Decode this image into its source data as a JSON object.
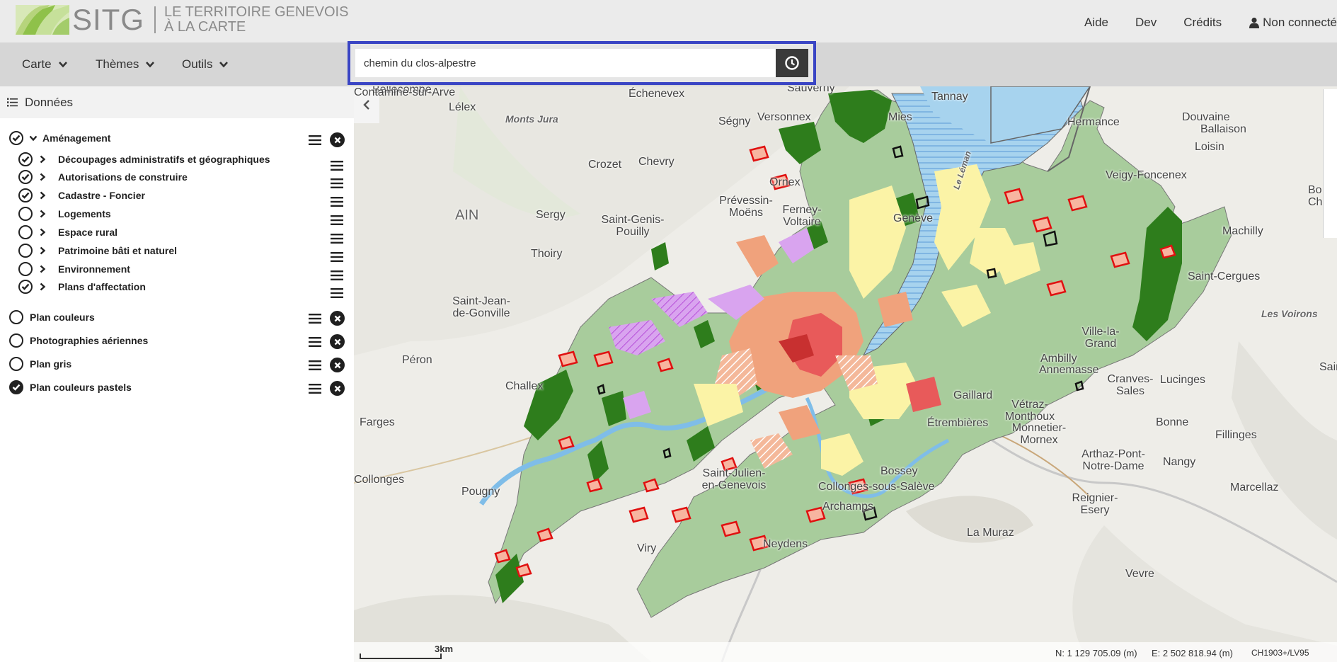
{
  "header": {
    "logo_main": "SITG",
    "logo_sub_1": "LE TERRITOIRE GENEVOIS",
    "logo_sub_2": "À LA CARTE",
    "nav": [
      "Aide",
      "Dev",
      "Crédits"
    ],
    "user": "Non connecté"
  },
  "toolbar": {
    "menus": [
      "Carte",
      "Thèmes",
      "Outils"
    ],
    "search_value": "chemin du clos-alpestre"
  },
  "sidebar": {
    "title": "Données",
    "groups": [
      {
        "label": "Aménagement",
        "checked": true,
        "expanded": true
      },
      {
        "label": "Plan couleurs",
        "checked": false
      },
      {
        "label": "Photographies aériennes",
        "checked": false
      },
      {
        "label": "Plan gris",
        "checked": false
      },
      {
        "label": "Plan couleurs pastels",
        "checked": true
      }
    ],
    "sublayers": [
      {
        "label": "Découpages administratifs et géographiques",
        "checked": true
      },
      {
        "label": "Autorisations de construire",
        "checked": true
      },
      {
        "label": "Cadastre - Foncier",
        "checked": true
      },
      {
        "label": "Logements",
        "checked": false
      },
      {
        "label": "Espace rural",
        "checked": false
      },
      {
        "label": "Patrimoine bâti et naturel",
        "checked": false
      },
      {
        "label": "Environnement",
        "checked": false
      },
      {
        "label": "Plans d'affectation",
        "checked": true
      }
    ]
  },
  "map": {
    "places": [
      "Bellecombe",
      "Lélex",
      "Échenevex",
      "Sauverny",
      "Tannay",
      "Monts Jura",
      "Ségny",
      "Versonnex",
      "Mies",
      "Hermance",
      "Douvaine",
      "Ballaison",
      "Loisin",
      "Crozet",
      "Chevry",
      "Ornex",
      "Veigy-Foncenex",
      "Bo",
      "Ch",
      "AIN",
      "Sergy",
      "Saint-Genis-Pouilly",
      "Prévessin-Moëns",
      "Ferney-Voltaire",
      "Machilly",
      "Thoiry",
      "Saint-Cergues",
      "Saint-Jean-de-Gonville",
      "Les Voirons",
      "Ville-la-Grand",
      "Ambilly",
      "Annemasse",
      "Péron",
      "Challex",
      "Cranves-Sales",
      "Lucinges",
      "Gaillard",
      "Vétraz-Monthoux",
      "Farges",
      "Bonne",
      "Étrembières",
      "Monnetier-Mornex",
      "Fillinges",
      "Arthaz-Pont-Notre-Dame",
      "Nangy",
      "Collonges",
      "Saint-Julien-en-Genevois",
      "Bossey",
      "Pougny",
      "Collonges-sous-Salève",
      "Reignier-Esery",
      "Marcellaz",
      "Archamps",
      "Contamine-sur-Arve",
      "La Muraz",
      "Neydens",
      "Viry",
      "Sain",
      "Vevre",
      "Le Léman",
      "Genève"
    ],
    "scale": "3km",
    "coord_n": "N: 1 129 705.09 (m)",
    "coord_e": "E: 2 502 818.94 (m)",
    "crs": "CH1903+/LV95"
  },
  "colors": {
    "accent_border": "#3a45c4",
    "forest": "#2e7d1c",
    "agricultural": "#a8cc9c",
    "lake": "#a7d3ee",
    "urban_yellow": "#fbf3a6",
    "urban_orange": "#f0a27c",
    "urban_red": "#e85a5a",
    "purple_zone": "#d9a4ef"
  }
}
